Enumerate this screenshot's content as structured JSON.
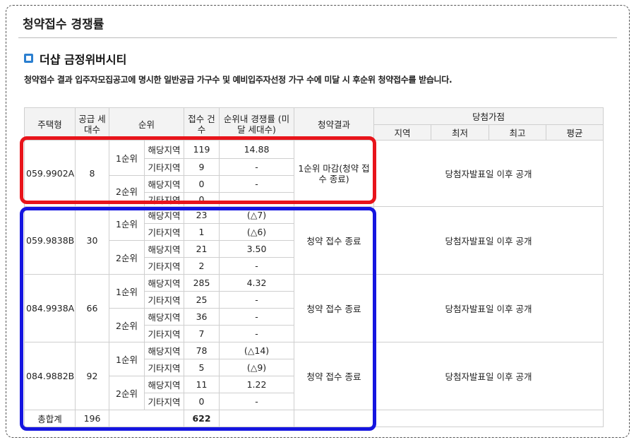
{
  "page": {
    "title": "청약접수 경쟁률"
  },
  "section": {
    "title": "더샵 금정위버시티",
    "note": "청약접수 결과 입주자모집공고에 명시한 일반공급 가구수 및 예비입주자선정 가구 수에 미달 시 후순위 청약접수를 받습니다."
  },
  "table": {
    "headers": {
      "type": "주택형",
      "supply": "공급 세대수",
      "rank": "순위",
      "applications": "접수 건수",
      "ratio": "순위내 경쟁률 (미달 세대수)",
      "result": "청약결과",
      "win_score": "당첨가점",
      "region": "지역",
      "min": "최저",
      "max": "최고",
      "avg": "평균"
    },
    "groups": [
      {
        "type": "059.9902A",
        "supply": "8",
        "result": "1순위 마감(청약 접수 종료)",
        "win_note": "당첨자발표일 이후 공개",
        "ranks": [
          {
            "rank": "1순위",
            "rows": [
              {
                "area": "해당지역",
                "count": "119",
                "ratio": "14.88"
              },
              {
                "area": "기타지역",
                "count": "9",
                "ratio": "-"
              }
            ]
          },
          {
            "rank": "2순위",
            "rows": [
              {
                "area": "해당지역",
                "count": "0",
                "ratio": "-"
              },
              {
                "area": "기타지역",
                "count": "0",
                "ratio": ""
              }
            ]
          }
        ]
      },
      {
        "type": "059.9838B",
        "supply": "30",
        "result": "청약 접수 종료",
        "win_note": "당첨자발표일 이후 공개",
        "ranks": [
          {
            "rank": "1순위",
            "rows": [
              {
                "area": "해당지역",
                "count": "23",
                "ratio": "(△7)"
              },
              {
                "area": "기타지역",
                "count": "1",
                "ratio": "(△6)"
              }
            ]
          },
          {
            "rank": "2순위",
            "rows": [
              {
                "area": "해당지역",
                "count": "21",
                "ratio": "3.50"
              },
              {
                "area": "기타지역",
                "count": "2",
                "ratio": "-"
              }
            ]
          }
        ]
      },
      {
        "type": "084.9938A",
        "supply": "66",
        "result": "청약 접수 종료",
        "win_note": "당첨자발표일 이후 공개",
        "ranks": [
          {
            "rank": "1순위",
            "rows": [
              {
                "area": "해당지역",
                "count": "285",
                "ratio": "4.32"
              },
              {
                "area": "기타지역",
                "count": "25",
                "ratio": "-"
              }
            ]
          },
          {
            "rank": "2순위",
            "rows": [
              {
                "area": "해당지역",
                "count": "36",
                "ratio": "-"
              },
              {
                "area": "기타지역",
                "count": "7",
                "ratio": "-"
              }
            ]
          }
        ]
      },
      {
        "type": "084.9882B",
        "supply": "92",
        "result": "청약 접수 종료",
        "win_note": "당첨자발표일 이후 공개",
        "ranks": [
          {
            "rank": "1순위",
            "rows": [
              {
                "area": "해당지역",
                "count": "78",
                "ratio": "(△14)"
              },
              {
                "area": "기타지역",
                "count": "5",
                "ratio": "(△9)"
              }
            ]
          },
          {
            "rank": "2순위",
            "rows": [
              {
                "area": "해당지역",
                "count": "11",
                "ratio": "1.22"
              },
              {
                "area": "기타지역",
                "count": "0",
                "ratio": "-"
              }
            ]
          }
        ]
      }
    ],
    "total": {
      "label": "총합계",
      "supply": "196",
      "count": "622"
    }
  },
  "annotations": {
    "red_box_color": "#e8141b",
    "blue_box_color": "#1515e0"
  }
}
